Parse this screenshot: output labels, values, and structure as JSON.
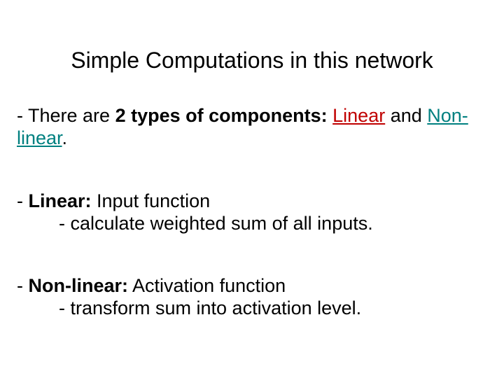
{
  "title": "Simple Computations in this network",
  "p1": {
    "lead": "- There are ",
    "bold": "2 types of components:",
    "linear": "Linear",
    "and": " and ",
    "nonlinear": "Non-linear",
    "period": "."
  },
  "p2": {
    "dash": "- ",
    "label": "Linear:",
    "rest": " Input function",
    "sub": "- calculate weighted sum of all inputs."
  },
  "p3": {
    "dash": "- ",
    "label": "Non-linear:",
    "rest": " Activation function",
    "sub": "- transform sum into activation level."
  }
}
